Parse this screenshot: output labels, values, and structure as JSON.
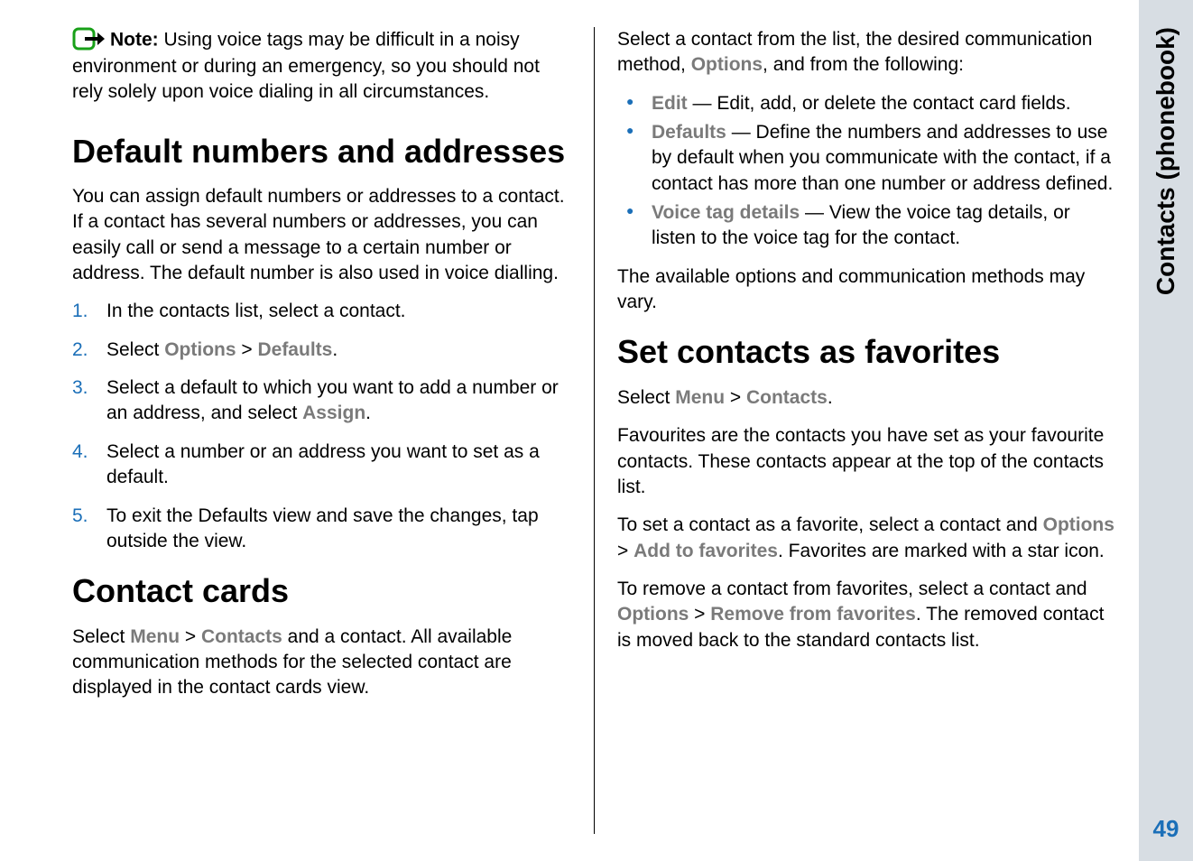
{
  "sidebar": {
    "title": "Contacts (phonebook)",
    "page_number": "49"
  },
  "left": {
    "note": {
      "label": "Note:",
      "text": "Using voice tags may be difficult in a noisy environment or during an emergency, so you should not rely solely upon voice dialing in all circumstances."
    },
    "h1": "Default numbers and addresses",
    "intro": "You can assign default numbers or addresses to a contact. If a contact has several numbers or addresses, you can easily call or send a message to a certain number or address. The default number is also used in voice dialling.",
    "steps": {
      "s1_num": "1.",
      "s1": "In the contacts list, select a contact.",
      "s2_num": "2.",
      "s2_pre": "Select ",
      "s2_opt": "Options",
      "s2_gt": " > ",
      "s2_def": "Defaults",
      "s2_post": ".",
      "s3_num": "3.",
      "s3_pre": "Select a default to which you want to add a number or an address, and select ",
      "s3_assign": "Assign",
      "s3_post": ".",
      "s4_num": "4.",
      "s4": "Select a number or an address you want to set as a default.",
      "s5_num": "5.",
      "s5": "To exit the Defaults view and save the changes, tap outside the view."
    },
    "h2": "Contact cards",
    "cc_p1_pre": "Select ",
    "cc_p1_menu": "Menu",
    "cc_p1_gt": " > ",
    "cc_p1_contacts": "Contacts",
    "cc_p1_post": " and a contact. All available communication methods for the selected contact are displayed in the contact cards view."
  },
  "right": {
    "intro_pre": "Select a contact from the list, the desired communication method, ",
    "intro_opt": "Options",
    "intro_post": ", and from the following:",
    "b1_term": "Edit",
    "b1_text": " — Edit, add, or delete the contact card fields.",
    "b2_term": "Defaults",
    "b2_text": " — Define the numbers and addresses to use by default when you communicate with the contact, if a contact has more than one number or address defined.",
    "b3_term": "Voice tag details",
    "b3_text": " — View the voice tag details, or listen to the voice tag for the contact.",
    "vary": "The available options and communication methods may vary.",
    "h1": "Set contacts as favorites",
    "fav_p1_pre": "Select ",
    "fav_p1_menu": "Menu",
    "fav_p1_gt": " > ",
    "fav_p1_contacts": "Contacts",
    "fav_p1_post": ".",
    "fav_p2": "Favourites are the contacts you have set as your favourite contacts. These contacts appear at the top of the contacts list.",
    "fav_p3_pre": "To set a contact as a favorite, select a contact and ",
    "fav_p3_opt": "Options",
    "fav_p3_gt": " > ",
    "fav_p3_add": "Add to favorites",
    "fav_p3_post": ". Favorites are marked with a star icon.",
    "fav_p4_pre": "To remove a contact from favorites, select a contact and ",
    "fav_p4_opt": "Options",
    "fav_p4_gt": " > ",
    "fav_p4_rem": "Remove from favorites",
    "fav_p4_post": ". The removed contact is moved back to the standard contacts list."
  }
}
